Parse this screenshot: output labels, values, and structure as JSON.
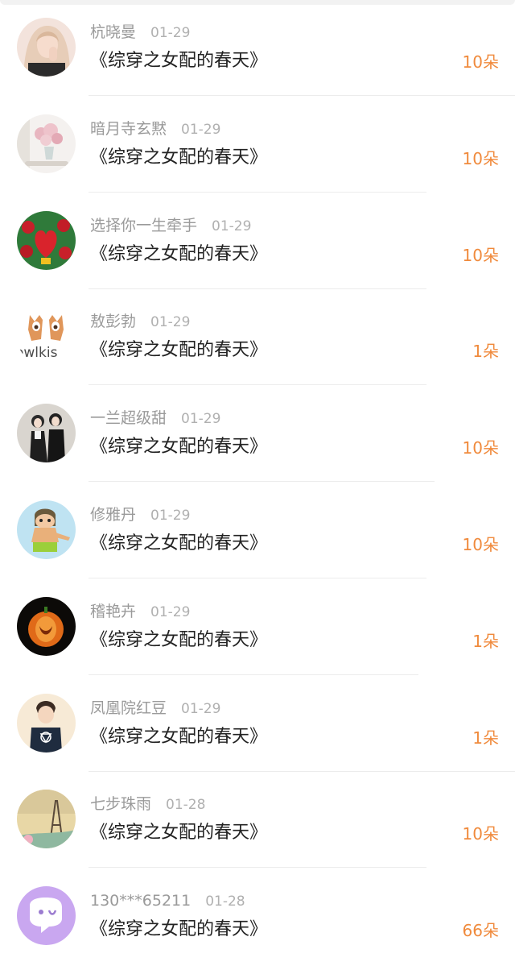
{
  "records": [
    {
      "name": "杭晓曼",
      "date": "01-29",
      "title": "《综穿之女配的春天》",
      "amount": "10朵",
      "avatar": "woman-portrait-icon"
    },
    {
      "name": "暗月寺玄黙",
      "date": "01-29",
      "title": "《综穿之女配的春天》",
      "amount": "10朵",
      "avatar": "flower-vase-icon"
    },
    {
      "name": "选择你一生牵手",
      "date": "01-29",
      "title": "《综穿之女配的春天》",
      "amount": "10朵",
      "avatar": "roses-heart-icon"
    },
    {
      "name": "敖彭勃",
      "date": "01-29",
      "title": "《综穿之女配的春天》",
      "amount": "1朵",
      "avatar": "owlkiss-logo-icon",
      "avatar_text": "owlkis"
    },
    {
      "name": "一兰超级甜",
      "date": "01-29",
      "title": "《综穿之女配的春天》",
      "amount": "10朵",
      "avatar": "couple-photo-icon"
    },
    {
      "name": "修雅丹",
      "date": "01-29",
      "title": "《综穿之女配的春天》",
      "amount": "10朵",
      "avatar": "cartoon-character-icon"
    },
    {
      "name": "稽艳卉",
      "date": "01-29",
      "title": "《综穿之女配的春天》",
      "amount": "1朵",
      "avatar": "pumpkin-icon"
    },
    {
      "name": "凤凰院红豆",
      "date": "01-29",
      "title": "《综穿之女配的春天》",
      "amount": "1朵",
      "avatar": "boy-portrait-icon"
    },
    {
      "name": "七步珠雨",
      "date": "01-28",
      "title": "《综穿之女配的春天》",
      "amount": "10朵",
      "avatar": "eiffel-tower-icon"
    },
    {
      "name": "130***65211",
      "date": "01-28",
      "title": "《综穿之女配的春天》",
      "amount": "66朵",
      "avatar": "chat-bubble-icon"
    }
  ],
  "colors": {
    "amount": "#f08a3c",
    "name": "#9a9a9a",
    "title": "#222222",
    "divider": "#ececec"
  }
}
